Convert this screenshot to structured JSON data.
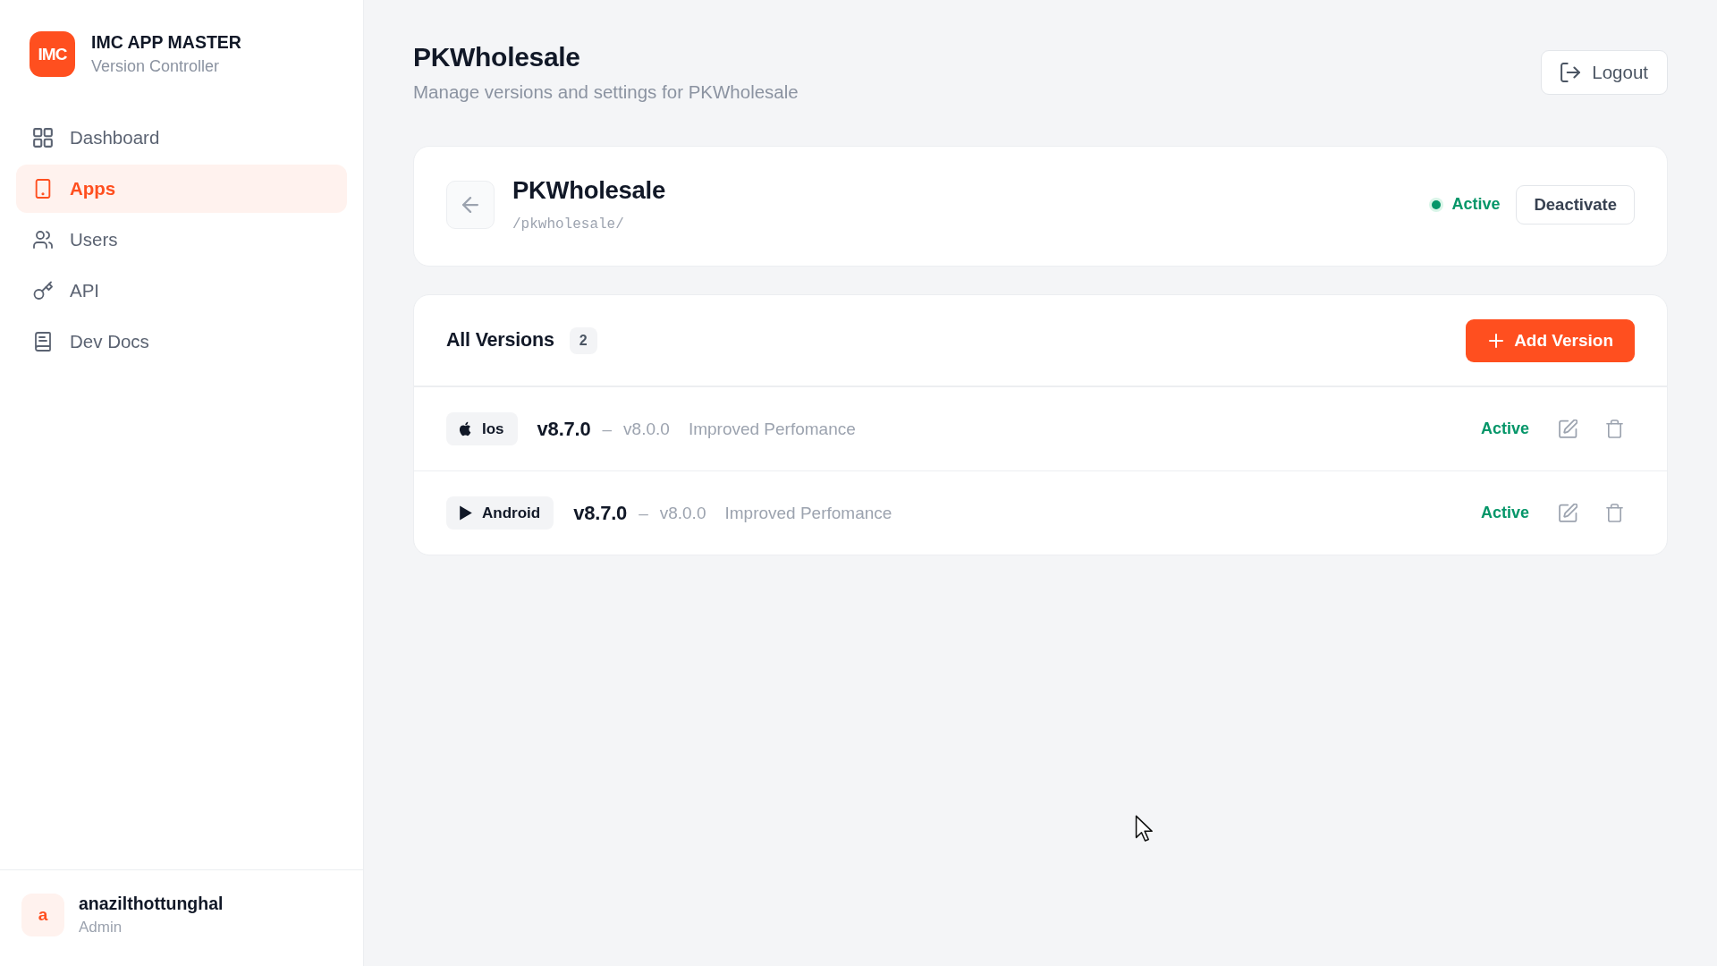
{
  "sidebar": {
    "logo": "IMC",
    "title": "IMC APP MASTER",
    "subtitle": "Version Controller",
    "items": [
      {
        "label": "Dashboard",
        "kind": "grid",
        "selected": false
      },
      {
        "label": "Apps",
        "kind": "phone",
        "selected": true
      },
      {
        "label": "Users",
        "kind": "users",
        "selected": false
      },
      {
        "label": "API",
        "kind": "key",
        "selected": false
      },
      {
        "label": "Dev Docs",
        "kind": "book",
        "selected": false
      }
    ],
    "user": {
      "initial": "a",
      "name": "anazilthottunghal",
      "role": "Admin"
    }
  },
  "header": {
    "title": "PKWholesale",
    "subtitle": "Manage versions and settings for PKWholesale",
    "logout": "Logout"
  },
  "app_card": {
    "name": "PKWholesale",
    "path": "/pkwholesale/",
    "status": "Active",
    "active": true,
    "action": "Deactivate"
  },
  "versions": {
    "title": "All Versions",
    "count": "2",
    "add_button": "Add Version",
    "rows": [
      {
        "platform": "Ios",
        "kind": "apple",
        "version": "v8.7.0",
        "separator": "–",
        "min_version": "v8.0.0",
        "notes": "Improved Perfomance",
        "status": "Active",
        "active": true
      },
      {
        "platform": "Android",
        "kind": "play",
        "version": "v8.7.0",
        "separator": "–",
        "min_version": "v8.0.0",
        "notes": "Improved Perfomance",
        "status": "Active",
        "active": true
      }
    ]
  }
}
